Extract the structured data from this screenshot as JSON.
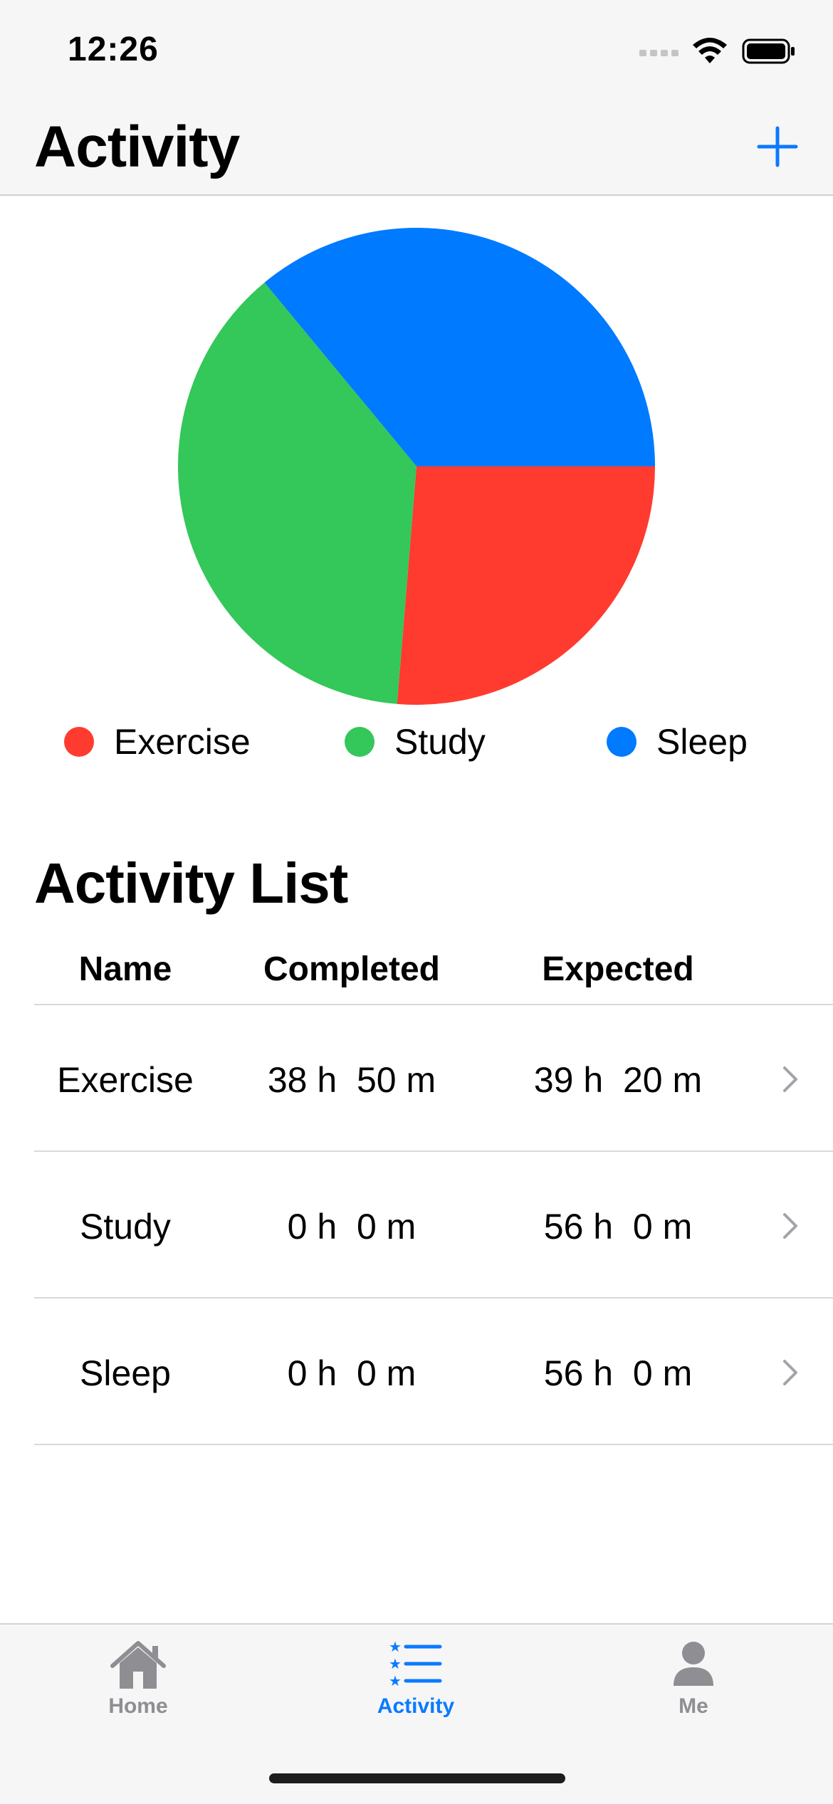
{
  "status_bar": {
    "time": "12:26"
  },
  "nav": {
    "title": "Activity",
    "add_icon": "plus-icon"
  },
  "chart_data": {
    "type": "pie",
    "labels": [
      "Exercise",
      "Study",
      "Sleep"
    ],
    "values": [
      38.8,
      0,
      0
    ],
    "slice_shares": [
      0.263,
      0.377,
      0.36
    ],
    "colors": [
      "#ff3b30",
      "#34c759",
      "#007aff"
    ],
    "legend_position": "bottom",
    "title": ""
  },
  "legend": [
    {
      "label": "Exercise",
      "color": "#ff3b30"
    },
    {
      "label": "Study",
      "color": "#34c759"
    },
    {
      "label": "Sleep",
      "color": "#007aff"
    }
  ],
  "activity_list": {
    "title": "Activity List",
    "headers": {
      "name": "Name",
      "completed": "Completed",
      "expected": "Expected"
    },
    "rows": [
      {
        "name": "Exercise",
        "completed": "38 h  50 m",
        "expected": "39 h  20 m"
      },
      {
        "name": "Study",
        "completed": "0 h  0 m",
        "expected": "56 h  0 m"
      },
      {
        "name": "Sleep",
        "completed": "0 h  0 m",
        "expected": "56 h  0 m"
      }
    ]
  },
  "tab_bar": {
    "tabs": [
      {
        "label": "Home",
        "icon": "house-icon",
        "active": false
      },
      {
        "label": "Activity",
        "icon": "list-star-icon",
        "active": true
      },
      {
        "label": "Me",
        "icon": "person-icon",
        "active": false
      }
    ]
  },
  "colors": {
    "accent": "#0a7aff",
    "inactive_tab": "#8e8e93",
    "chevron": "#a3a3a8"
  }
}
